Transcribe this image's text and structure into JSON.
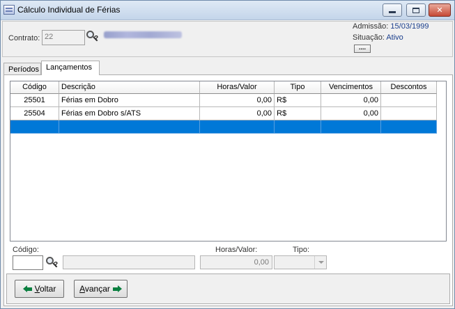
{
  "window": {
    "title": "Cálculo Individual de Férias"
  },
  "header": {
    "contrato_label": "Contrato:",
    "contrato_value": "22",
    "employee_name_redacted": true,
    "admissao_label": "Admissão:",
    "admissao_value": "15/03/1999",
    "situacao_label": "Situação:",
    "situacao_value": "Ativo",
    "ellipsis_button": "...."
  },
  "tabs": [
    {
      "label": "Períodos",
      "active": false
    },
    {
      "label": "Lançamentos",
      "active": true
    }
  ],
  "grid": {
    "columns": [
      "Código",
      "Descrição",
      "Horas/Valor",
      "Tipo",
      "Vencimentos",
      "Descontos"
    ],
    "rows": [
      {
        "codigo": "25501",
        "descricao": "Férias em Dobro",
        "horas_valor": "0,00",
        "tipo": "R$",
        "vencimentos": "0,00",
        "descontos": ""
      },
      {
        "codigo": "25504",
        "descricao": "Férias em Dobro s/ATS",
        "horas_valor": "0,00",
        "tipo": "R$",
        "vencimentos": "0,00",
        "descontos": ""
      },
      {
        "codigo": "",
        "descricao": "",
        "horas_valor": "",
        "tipo": "",
        "vencimentos": "",
        "descontos": "",
        "selected": true
      }
    ]
  },
  "entry": {
    "codigo_label": "Código:",
    "codigo_value": "",
    "descricao_value": "",
    "horas_label": "Horas/Valor:",
    "horas_value": "0,00",
    "tipo_label": "Tipo:",
    "tipo_value": ""
  },
  "navigation": {
    "voltar_prefix": "",
    "voltar_accel": "V",
    "voltar_rest": "oltar",
    "avancar_prefix": "A",
    "avancar_accel": "v",
    "avancar_rest": "ançar"
  },
  "colors": {
    "selection": "#0078d7",
    "info_value": "#1a3e8c",
    "arrow_green": "#0a7f3f"
  }
}
